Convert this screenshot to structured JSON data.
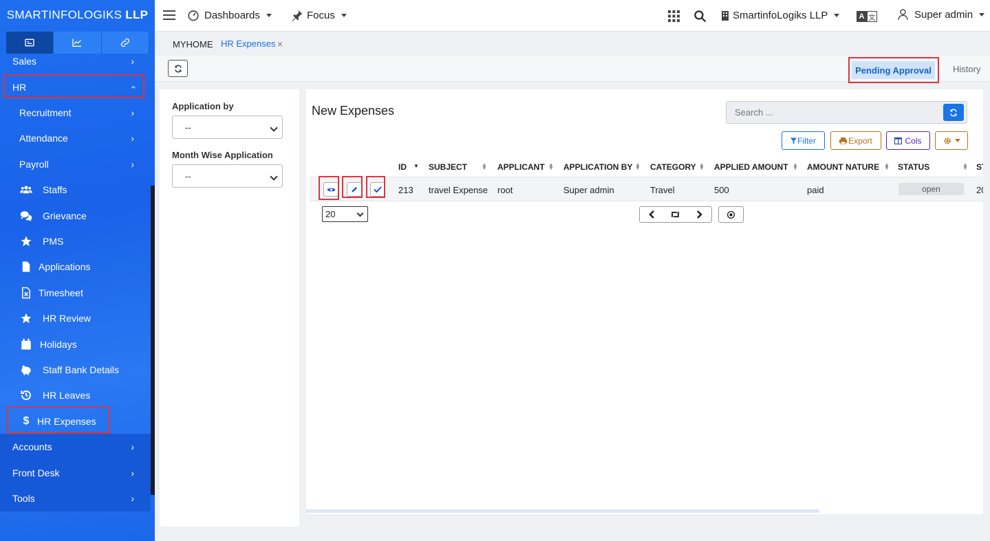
{
  "brand": {
    "name": "SMARTINFOLOGIKS",
    "suffix": "LLP"
  },
  "sidebar": {
    "tabs": [
      {
        "icon": "id-card-icon"
      },
      {
        "icon": "chart-line-icon"
      },
      {
        "icon": "link-icon"
      }
    ],
    "items": [
      {
        "label": "Sales",
        "type": "top"
      },
      {
        "label": "HR",
        "type": "top"
      },
      {
        "label": "Recruitment",
        "type": "sub"
      },
      {
        "label": "Attendance",
        "type": "sub"
      },
      {
        "label": "Payroll",
        "type": "sub"
      },
      {
        "label": "Staffs",
        "type": "icon"
      },
      {
        "label": "Grievance",
        "type": "icon"
      },
      {
        "label": "PMS",
        "type": "icon"
      },
      {
        "label": "Applications",
        "type": "icon"
      },
      {
        "label": "Timesheet",
        "type": "icon"
      },
      {
        "label": "HR Review",
        "type": "icon"
      },
      {
        "label": "Holidays",
        "type": "icon"
      },
      {
        "label": "Staff Bank Details",
        "type": "icon"
      },
      {
        "label": "HR Leaves",
        "type": "icon"
      },
      {
        "label": "HR Expenses",
        "type": "icon"
      },
      {
        "label": "Accounts",
        "type": "top"
      },
      {
        "label": "Front Desk",
        "type": "top"
      },
      {
        "label": "Tools",
        "type": "top"
      }
    ]
  },
  "topbar": {
    "dashboards": "Dashboards",
    "focus": "Focus",
    "company": "SmartinfoLogiks LLP",
    "user": "Super admin"
  },
  "breadcrumb": {
    "home": "MYHOME",
    "current": "HR Expenses",
    "close": "×"
  },
  "tabs": {
    "pending": "Pending Approval",
    "history": "History"
  },
  "filters": {
    "application_by": {
      "label": "Application by",
      "value": "--"
    },
    "month_wise": {
      "label": "Month Wise Application",
      "value": "--"
    }
  },
  "main": {
    "title": "New Expenses",
    "search_placeholder": "Search ...",
    "buttons": {
      "filter": "Filter",
      "export": "Export",
      "cols": "Cols"
    },
    "columns": [
      "ID",
      "SUBJECT",
      "APPLICANT",
      "APPLICATION BY",
      "CATEGORY",
      "APPLIED AMOUNT",
      "AMOUNT NATURE",
      "STATUS",
      "ST"
    ],
    "rows": [
      {
        "id": "213",
        "subject": "travel Expense",
        "applicant": "root",
        "application_by": "Super admin",
        "category": "Travel",
        "applied_amount": "500",
        "amount_nature": "paid",
        "status": "open",
        "extra": "20"
      }
    ],
    "page_size": "20"
  },
  "colors": {
    "sidebar_blue": "#1f6ff0",
    "accent": "#1a73e8",
    "highlight": "#d9363e",
    "export": "#b8741a",
    "cols": "#5b21b6"
  }
}
